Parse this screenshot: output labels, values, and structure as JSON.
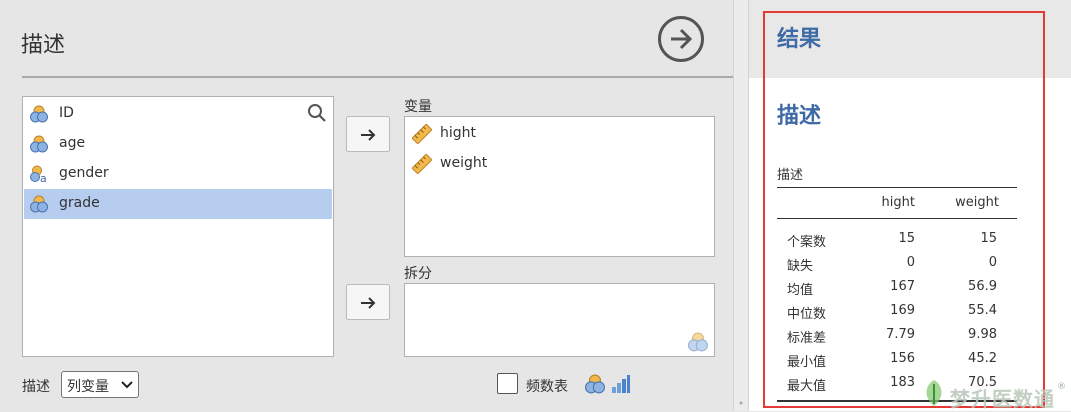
{
  "left": {
    "title": "描述",
    "variables": [
      {
        "name": "ID",
        "type": "nominal"
      },
      {
        "name": "age",
        "type": "nominal"
      },
      {
        "name": "gender",
        "type": "nominal-text"
      },
      {
        "name": "grade",
        "type": "nominal",
        "selected": true
      }
    ],
    "targets_label": "变量",
    "targets": [
      {
        "name": "hight",
        "type": "continuous"
      },
      {
        "name": "weight",
        "type": "continuous"
      }
    ],
    "split_label": "拆分",
    "describe_label": "描述",
    "describe_select": "列变量",
    "freq_label": "频数表"
  },
  "right": {
    "results_title": "结果",
    "section_title": "描述",
    "table_title": "描述",
    "columns": [
      "",
      "hight",
      "weight"
    ],
    "rows": [
      {
        "label": "个案数",
        "hight": "15",
        "weight": "15"
      },
      {
        "label": "缺失",
        "hight": "0",
        "weight": "0"
      },
      {
        "label": "均值",
        "hight": "167",
        "weight": "56.9"
      },
      {
        "label": "中位数",
        "hight": "169",
        "weight": "55.4"
      },
      {
        "label": "标准差",
        "hight": "7.79",
        "weight": "9.98"
      },
      {
        "label": "最小值",
        "hight": "156",
        "weight": "45.2"
      },
      {
        "label": "最大值",
        "hight": "183",
        "weight": "70.5"
      }
    ]
  },
  "watermark": {
    "text": "梦升医数通",
    "reg": "®"
  },
  "colors": {
    "accent": "#3e6aa6",
    "highlight_frame": "#e53935",
    "selected_row": "#b6cdef"
  }
}
